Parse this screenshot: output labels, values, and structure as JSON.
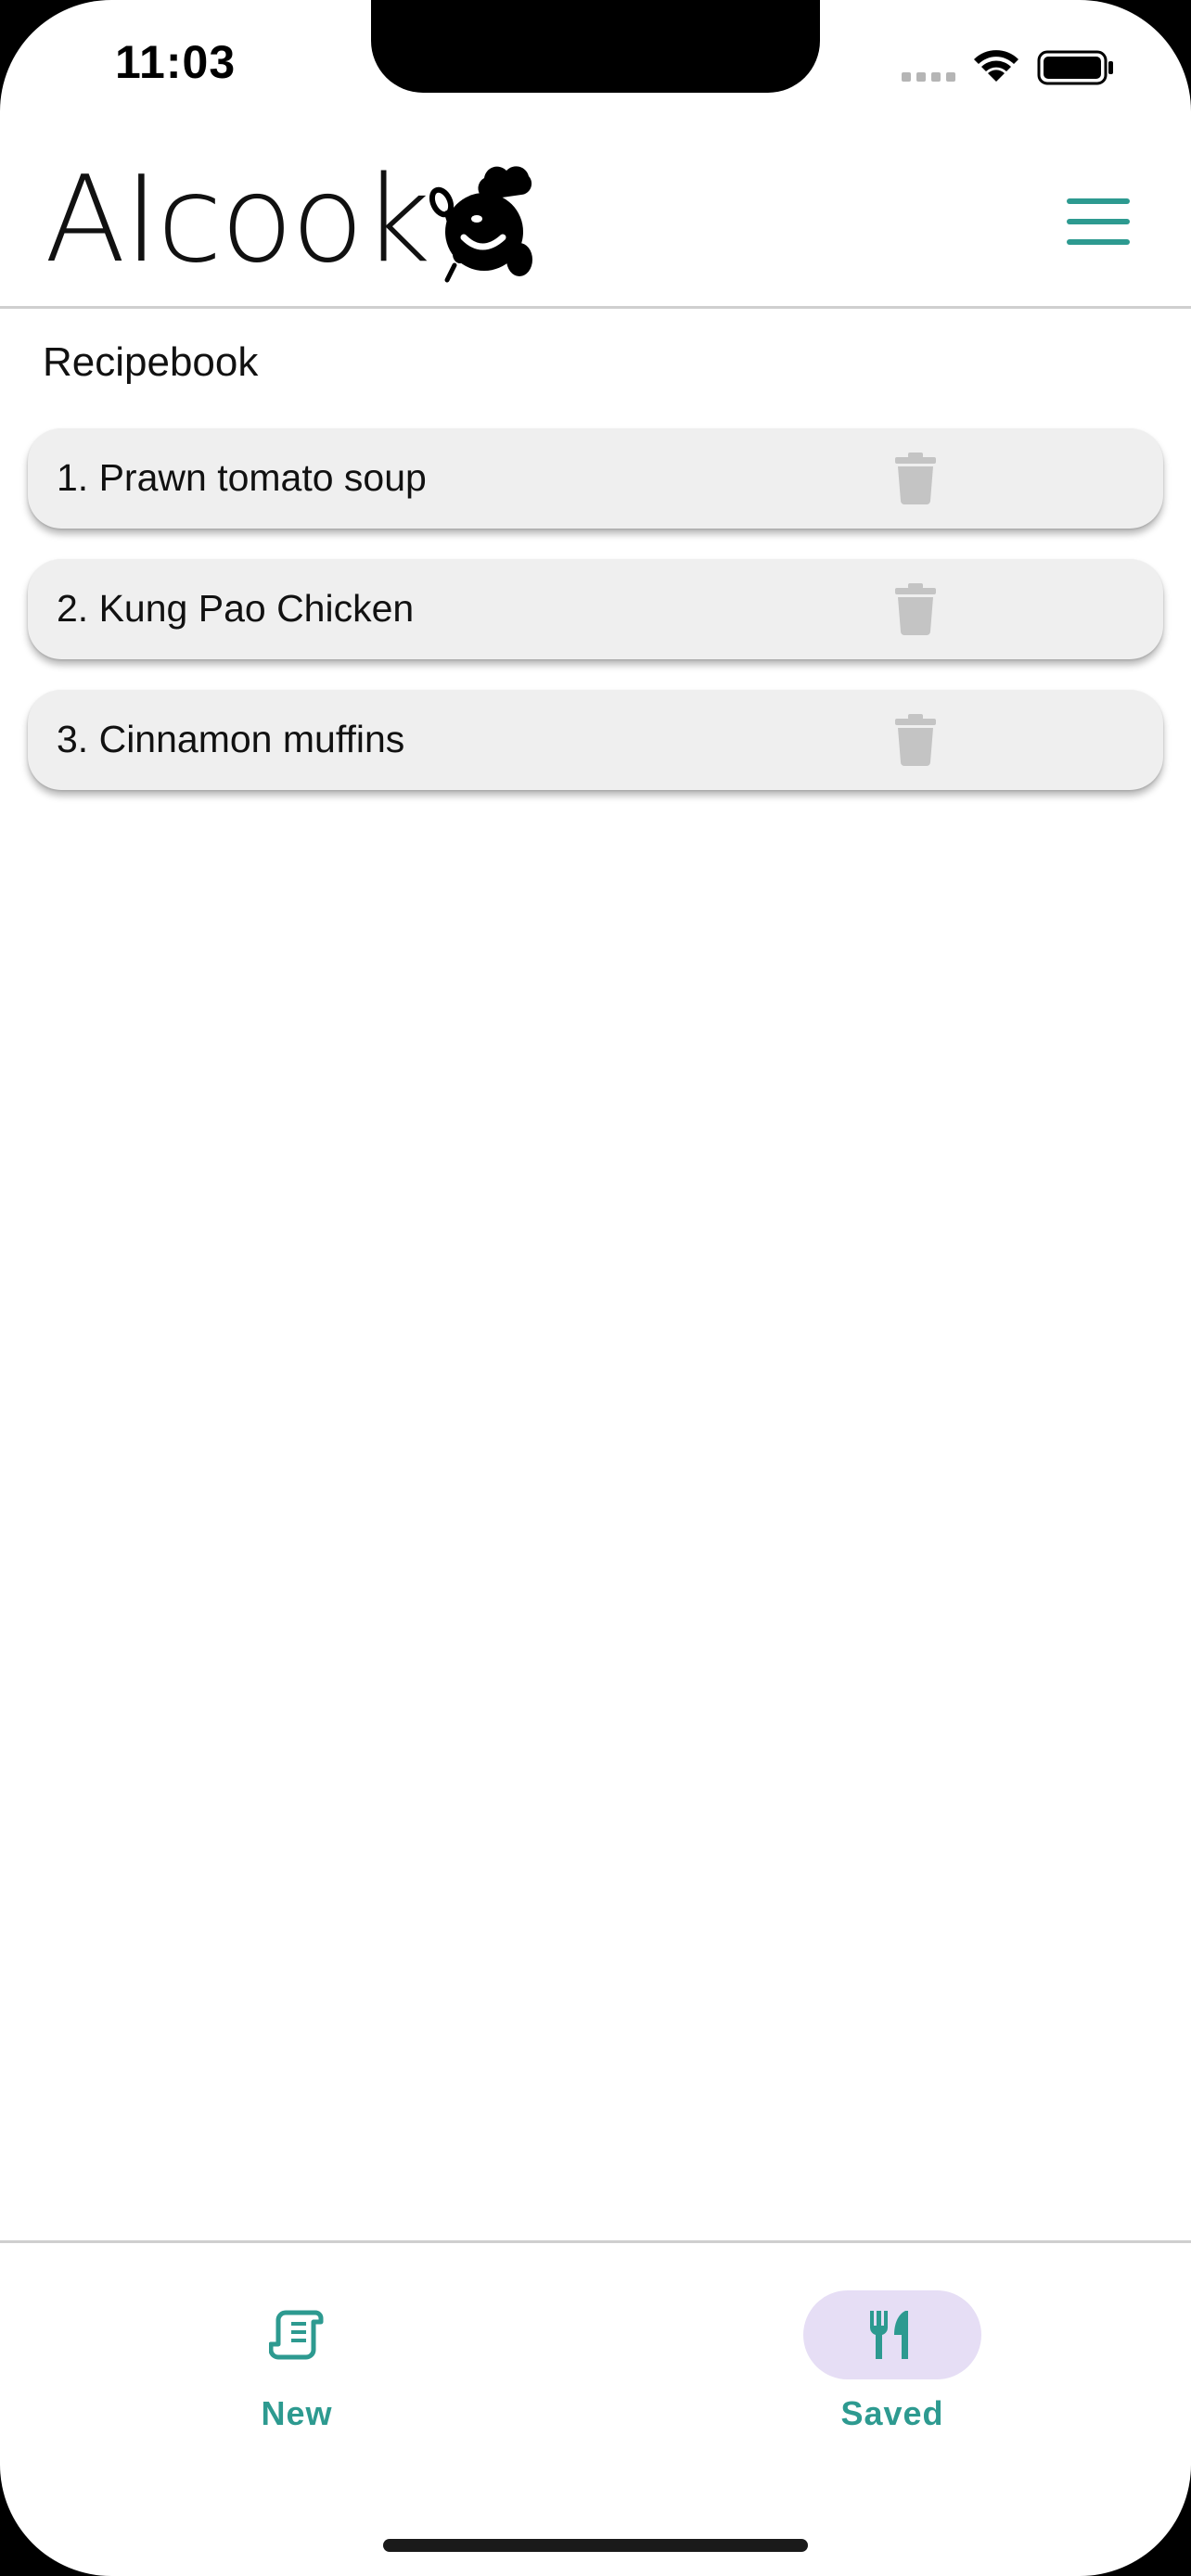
{
  "status_bar": {
    "time": "11:03"
  },
  "header": {
    "logo_text": "AIcook",
    "menu_icon": "hamburger-menu-icon",
    "accent_color": "#2d9a90"
  },
  "section_title": "Recipebook",
  "recipes": [
    {
      "label": "1. Prawn tomato soup"
    },
    {
      "label": "2. Kung Pao Chicken"
    },
    {
      "label": "3. Cinnamon muffins"
    }
  ],
  "recipe_action_icon": "trash-icon",
  "bottom_nav": {
    "items": [
      {
        "label": "New",
        "icon": "recipe-scroll-icon",
        "active": false
      },
      {
        "label": "Saved",
        "icon": "fork-knife-icon",
        "active": true
      }
    ],
    "active_pill_color": "#e6def5"
  }
}
